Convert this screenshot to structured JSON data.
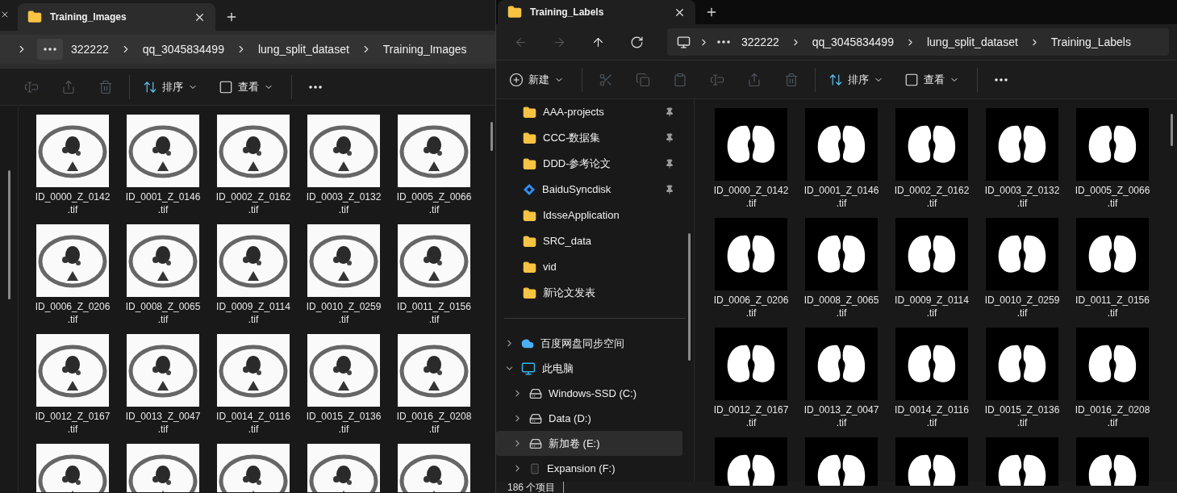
{
  "windows": [
    {
      "tab": {
        "title": "Training_Images",
        "selected": true
      },
      "address": {
        "crumbs": [
          "322222",
          "qq_3045834499",
          "lung_split_dataset",
          "Training_Images"
        ]
      },
      "toolbar": [
        {
          "kind": "rename",
          "disabled": true
        },
        {
          "kind": "share",
          "disabled": true
        },
        {
          "kind": "delete",
          "disabled": true
        },
        {
          "kind": "sort",
          "label": "排序",
          "disabled": false
        },
        {
          "kind": "view",
          "label": "查看",
          "disabled": false
        },
        {
          "kind": "more",
          "disabled": false
        }
      ],
      "files": [
        {
          "kind": "ct-scan",
          "name_lines": [
            "ID_0000_Z_0142",
            ".tif"
          ]
        },
        {
          "kind": "ct-scan",
          "name_lines": [
            "ID_0001_Z_0146",
            ".tif"
          ]
        },
        {
          "kind": "ct-scan",
          "name_lines": [
            "ID_0002_Z_0162",
            ".tif"
          ]
        },
        {
          "kind": "ct-scan",
          "name_lines": [
            "ID_0003_Z_0132",
            ".tif"
          ]
        },
        {
          "kind": "ct-scan",
          "name_lines": [
            "ID_0005_Z_0066",
            ".tif"
          ]
        },
        {
          "kind": "ct-scan",
          "name_lines": [
            "ID_0006_Z_0206",
            ".tif"
          ]
        },
        {
          "kind": "ct-scan",
          "name_lines": [
            "ID_0008_Z_0065",
            ".tif"
          ]
        },
        {
          "kind": "ct-scan",
          "name_lines": [
            "ID_0009_Z_0114",
            ".tif"
          ]
        },
        {
          "kind": "ct-scan",
          "name_lines": [
            "ID_0010_Z_0259",
            ".tif"
          ]
        },
        {
          "kind": "ct-scan",
          "name_lines": [
            "ID_0011_Z_0156",
            ".tif"
          ]
        },
        {
          "kind": "ct-scan",
          "name_lines": [
            "ID_0012_Z_0167",
            ".tif"
          ]
        },
        {
          "kind": "ct-scan",
          "name_lines": [
            "ID_0013_Z_0047",
            ".tif"
          ]
        },
        {
          "kind": "ct-scan",
          "name_lines": [
            "ID_0014_Z_0116",
            ".tif"
          ]
        },
        {
          "kind": "ct-scan",
          "name_lines": [
            "ID_0015_Z_0136",
            ".tif"
          ]
        },
        {
          "kind": "ct-scan",
          "name_lines": [
            "ID_0016_Z_0208",
            ".tif"
          ]
        }
      ],
      "partial_row": [
        {
          "kind": "ct-scan"
        },
        {
          "kind": "ct-scan"
        },
        {
          "kind": "ct-scan"
        },
        {
          "kind": "ct-scan"
        },
        {
          "kind": "ct-scan"
        }
      ]
    },
    {
      "tab": {
        "title": "Training_Labels",
        "selected": true
      },
      "nav_buttons": [
        {
          "kind": "back",
          "disabled": true
        },
        {
          "kind": "forward",
          "disabled": true
        },
        {
          "kind": "up",
          "disabled": false
        },
        {
          "kind": "refresh",
          "disabled": false
        }
      ],
      "address": {
        "crumbs": [
          "322222",
          "qq_3045834499",
          "lung_split_dataset",
          "Training_Labels"
        ]
      },
      "toolbar": [
        {
          "kind": "new",
          "label": "新建",
          "disabled": false
        },
        {
          "kind": "cut",
          "disabled": true
        },
        {
          "kind": "copy",
          "disabled": true
        },
        {
          "kind": "paste",
          "disabled": true
        },
        {
          "kind": "rename",
          "disabled": true
        },
        {
          "kind": "share",
          "disabled": true
        },
        {
          "kind": "delete",
          "disabled": true
        },
        {
          "kind": "sort",
          "label": "排序",
          "disabled": false
        },
        {
          "kind": "view",
          "label": "查看",
          "disabled": false
        },
        {
          "kind": "more",
          "disabled": false
        }
      ],
      "nav_pane": {
        "quick_access": [
          {
            "label": "AAA-projects",
            "kind": "folder",
            "pinned": true,
            "selected": false
          },
          {
            "label": "CCC-数据集",
            "kind": "folder",
            "pinned": true,
            "selected": false
          },
          {
            "label": "DDD-参考论文",
            "kind": "folder",
            "pinned": true,
            "selected": false
          },
          {
            "label": "BaiduSyncdisk",
            "kind": "sync",
            "pinned": true,
            "selected": false
          },
          {
            "label": "IdsseApplication",
            "kind": "folder",
            "pinned": false,
            "selected": false
          },
          {
            "label": "SRC_data",
            "kind": "folder",
            "pinned": false,
            "selected": false
          },
          {
            "label": "vid",
            "kind": "folder",
            "pinned": false,
            "selected": false
          },
          {
            "label": "新论文发表",
            "kind": "folder",
            "pinned": false,
            "selected": false
          }
        ],
        "tree": [
          {
            "label": "百度网盘同步空间",
            "kind": "cloud",
            "expanded": false,
            "selected": false
          },
          {
            "label": "此电脑",
            "kind": "computer",
            "expanded": true,
            "selected": false,
            "children": [
              {
                "label": "Windows-SSD (C:)",
                "kind": "system-drive",
                "expanded": false,
                "selected": false
              },
              {
                "label": "Data (D:)",
                "kind": "drive",
                "expanded": false,
                "selected": false
              },
              {
                "label": "新加卷 (E:)",
                "kind": "drive",
                "expanded": false,
                "selected": true
              },
              {
                "label": "Expansion (F:)",
                "kind": "external-drive",
                "expanded": false,
                "selected": false
              }
            ]
          }
        ]
      },
      "files": [
        {
          "kind": "mask",
          "name_lines": [
            "ID_0000_Z_0142",
            ".tif"
          ]
        },
        {
          "kind": "mask",
          "name_lines": [
            "ID_0001_Z_0146",
            ".tif"
          ]
        },
        {
          "kind": "mask",
          "name_lines": [
            "ID_0002_Z_0162",
            ".tif"
          ]
        },
        {
          "kind": "mask",
          "name_lines": [
            "ID_0003_Z_0132",
            ".tif"
          ]
        },
        {
          "kind": "mask",
          "name_lines": [
            "ID_0005_Z_0066",
            ".tif"
          ]
        },
        {
          "kind": "mask",
          "name_lines": [
            "ID_0006_Z_0206",
            ".tif"
          ]
        },
        {
          "kind": "mask",
          "name_lines": [
            "ID_0008_Z_0065",
            ".tif"
          ]
        },
        {
          "kind": "mask",
          "name_lines": [
            "ID_0009_Z_0114",
            ".tif"
          ]
        },
        {
          "kind": "mask",
          "name_lines": [
            "ID_0010_Z_0259",
            ".tif"
          ]
        },
        {
          "kind": "mask",
          "name_lines": [
            "ID_0011_Z_0156",
            ".tif"
          ]
        },
        {
          "kind": "mask",
          "name_lines": [
            "ID_0012_Z_0167",
            ".tif"
          ]
        },
        {
          "kind": "mask",
          "name_lines": [
            "ID_0013_Z_0047",
            ".tif"
          ]
        },
        {
          "kind": "mask",
          "name_lines": [
            "ID_0014_Z_0116",
            ".tif"
          ]
        },
        {
          "kind": "mask",
          "name_lines": [
            "ID_0015_Z_0136",
            ".tif"
          ]
        },
        {
          "kind": "mask",
          "name_lines": [
            "ID_0016_Z_0208",
            ".tif"
          ]
        }
      ],
      "partial_row": [
        {
          "kind": "mask"
        },
        {
          "kind": "mask"
        },
        {
          "kind": "mask"
        },
        {
          "kind": "mask"
        },
        {
          "kind": "mask"
        }
      ],
      "status_bar": {
        "item_count": "186 个项目"
      }
    }
  ]
}
